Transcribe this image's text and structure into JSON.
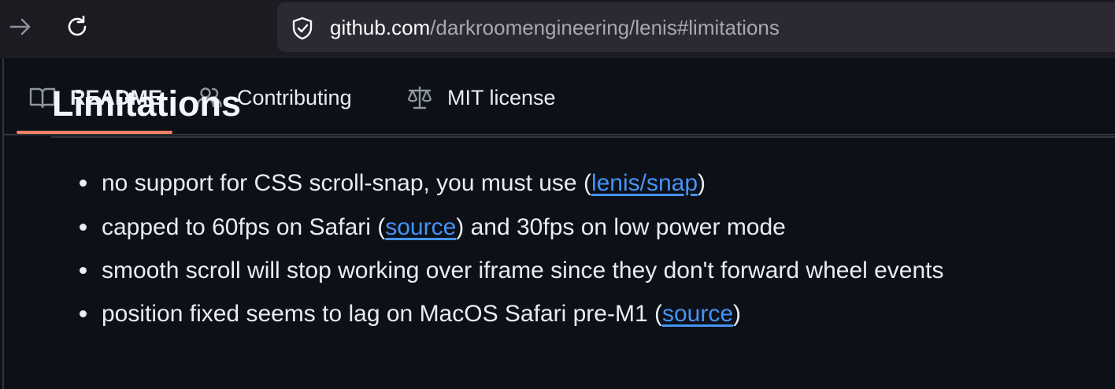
{
  "browser": {
    "url_host": "github.com",
    "url_path": "/darkroomengineering/lenis#limitations",
    "forward_icon": "arrow-right-icon",
    "reload_icon": "reload-icon",
    "security_icon": "shield-check-icon"
  },
  "tabs": [
    {
      "label": "README",
      "icon": "book-icon",
      "active": true
    },
    {
      "label": "Contributing",
      "icon": "people-icon",
      "active": false
    },
    {
      "label": "MIT license",
      "icon": "law-scale-icon",
      "active": false
    }
  ],
  "section": {
    "title": "Limitations"
  },
  "limitations": [
    {
      "before": "no support for CSS scroll-snap, you must use (",
      "link": "lenis/snap",
      "after": ")"
    },
    {
      "before": "capped to 60fps on Safari (",
      "link": "source",
      "after": ") and 30fps on low power mode"
    },
    {
      "before": "smooth scroll will stop working over iframe since they don't forward wheel events",
      "link": "",
      "after": ""
    },
    {
      "before": "position fixed seems to lag on MacOS Safari pre-M1 (",
      "link": "source",
      "after": ")"
    }
  ],
  "colors": {
    "page_bg": "#0d1117",
    "browser_bg": "#1c1b22",
    "url_bar_bg": "#2b2a33",
    "tab_underline": "#f78166",
    "link": "#4493f8",
    "border": "#30363d"
  }
}
